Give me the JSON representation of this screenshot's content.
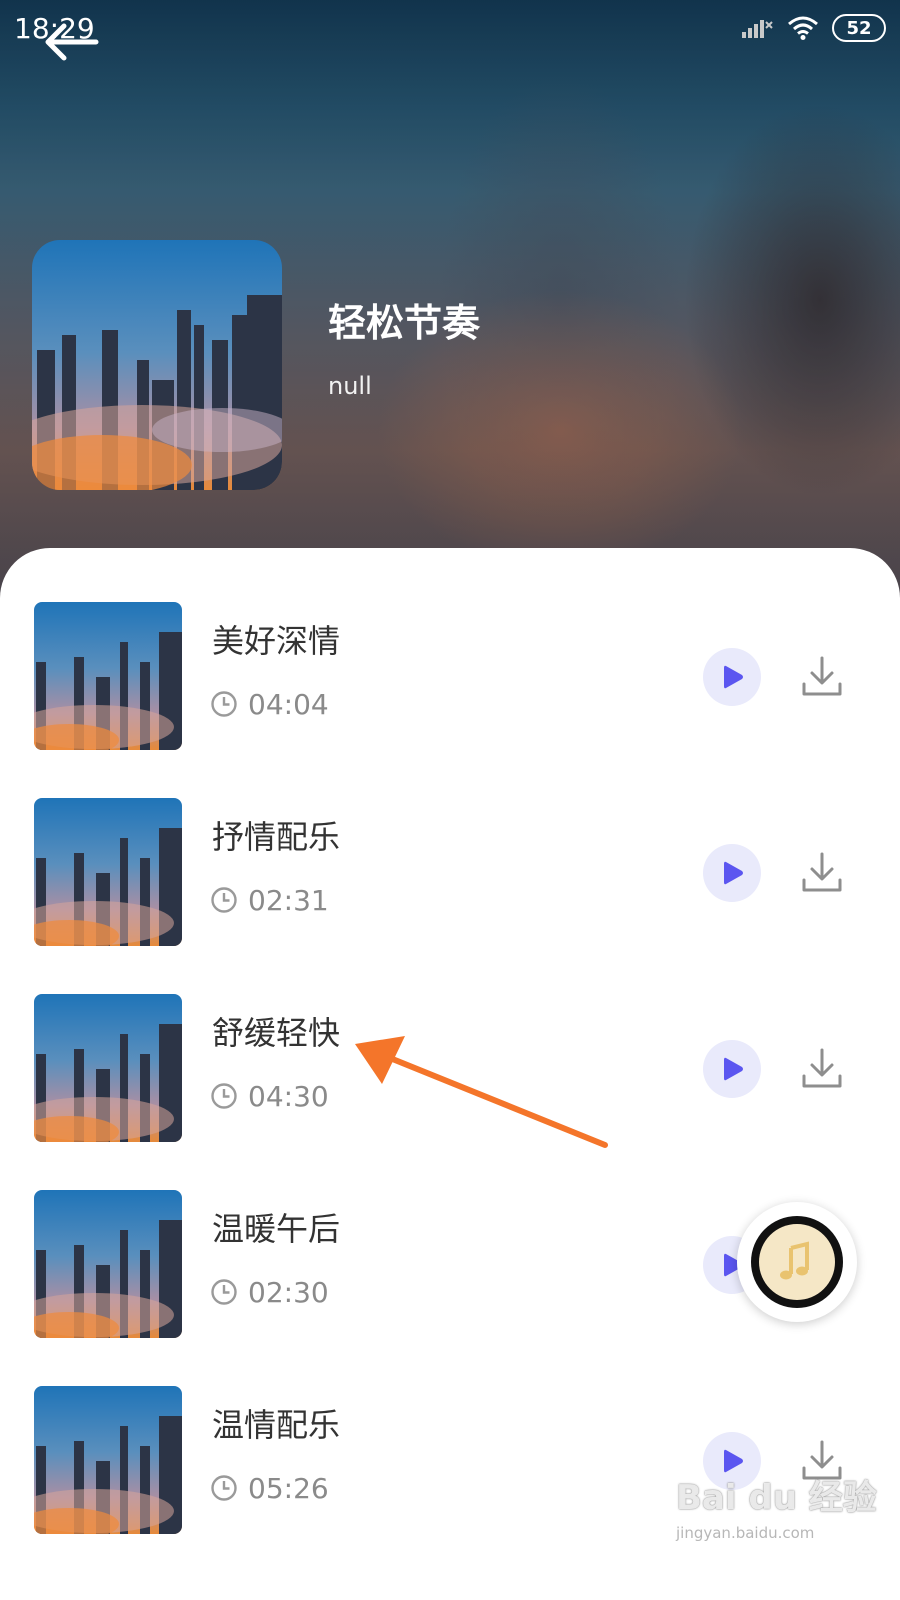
{
  "status_bar": {
    "time": "18:29",
    "battery": "52"
  },
  "playlist": {
    "title": "轻松节奏",
    "subtitle": "null"
  },
  "songs": [
    {
      "title": "美好深情",
      "duration": "04:04"
    },
    {
      "title": "抒情配乐",
      "duration": "02:31"
    },
    {
      "title": "舒缓轻快",
      "duration": "04:30"
    },
    {
      "title": "温暖午后",
      "duration": "02:30"
    },
    {
      "title": "温情配乐",
      "duration": "05:26"
    }
  ],
  "watermark": {
    "brand": "Bai du 经验",
    "url": "jingyan.baidu.com"
  },
  "colors": {
    "accent": "#5b56f0",
    "play_bg": "#e9eafb",
    "annotation_arrow": "#f4752a"
  },
  "icons": [
    "back-arrow-icon",
    "signal-icon",
    "wifi-icon",
    "battery-icon",
    "clock-icon",
    "play-icon",
    "download-icon",
    "music-disc-icon"
  ]
}
